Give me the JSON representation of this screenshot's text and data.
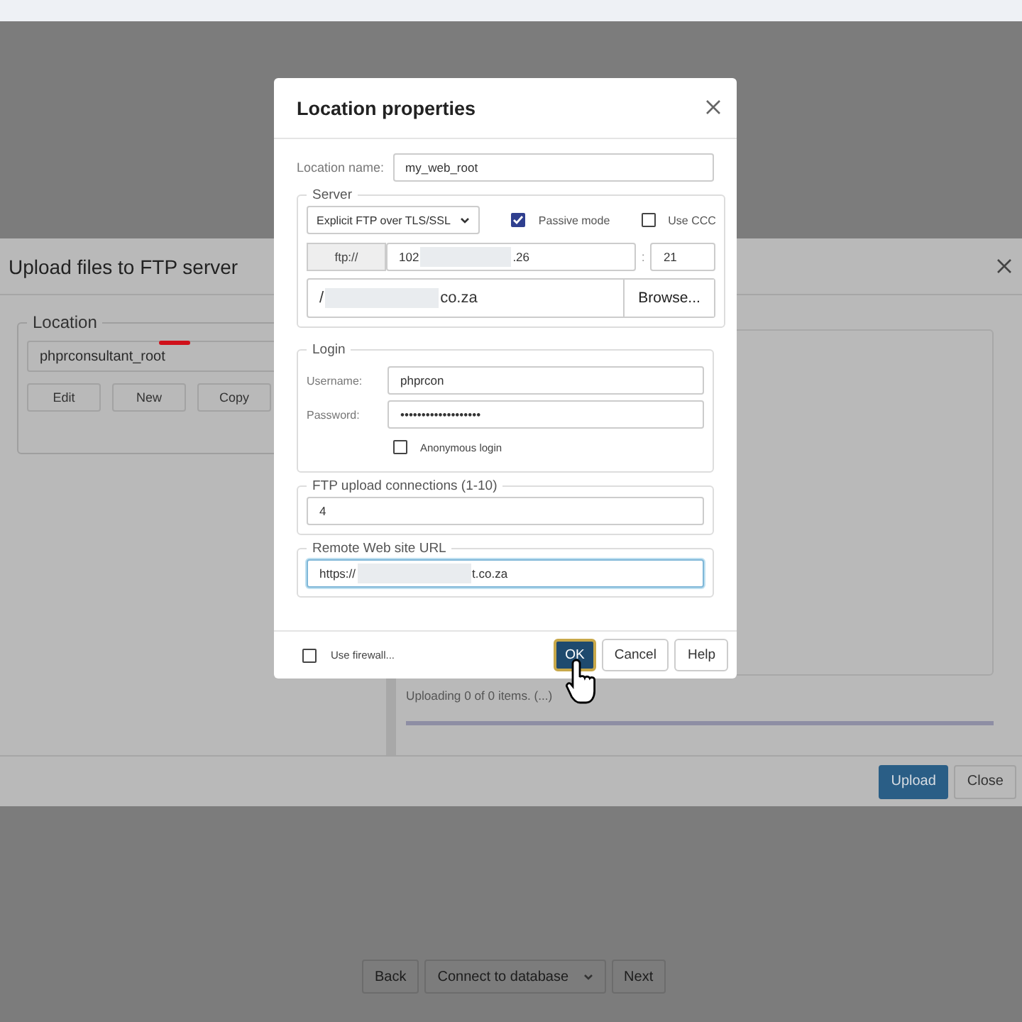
{
  "upload_dialog": {
    "title": "Upload files to FTP server",
    "location": {
      "legend": "Location",
      "value": "phprconsultant_root",
      "buttons": [
        "Edit",
        "New",
        "Copy"
      ]
    },
    "status": "Uploading 0 of 0 items. (...)",
    "progress": {
      "level": 0
    },
    "buttons": [
      {
        "label": "Upload",
        "primary": true
      },
      {
        "label": "Close",
        "primary": false
      }
    ]
  },
  "location_dialog": {
    "title": "Location properties",
    "location_name": {
      "label": "Location name:",
      "value": "my_web_root"
    },
    "server": {
      "legend": "Server",
      "protocol": "Explicit FTP over TLS/SSL",
      "options": [
        {
          "label": "Passive mode",
          "checked": true
        },
        {
          "label": "Use CCC",
          "checked": false
        }
      ],
      "scheme": "ftp://",
      "host_parts": [
        "102",
        ".26"
      ],
      "separator": ":",
      "port": "21",
      "path_parts": [
        "/",
        "co.za"
      ],
      "browse": "Browse..."
    },
    "login": {
      "legend": "Login",
      "username_label": "Username:",
      "username": "phprcon",
      "password_label": "Password:",
      "password": "•••••••••••••••••••",
      "anonymous": {
        "label": "Anonymous login",
        "checked": false
      }
    },
    "connections": {
      "legend": "FTP upload connections (1-10)",
      "value": "4"
    },
    "url": {
      "legend": "Remote Web site URL",
      "value_parts": [
        "https://",
        "t.co.za"
      ],
      "focused": true
    },
    "firewall": {
      "label": "Use firewall...",
      "checked": false
    },
    "buttons": [
      {
        "label": "OK",
        "primary": true
      },
      {
        "label": "Cancel",
        "primary": false
      },
      {
        "label": "Help",
        "primary": false
      }
    ]
  },
  "bottom_nav": {
    "back": "Back",
    "step": "Connect to database",
    "next": "Next"
  }
}
